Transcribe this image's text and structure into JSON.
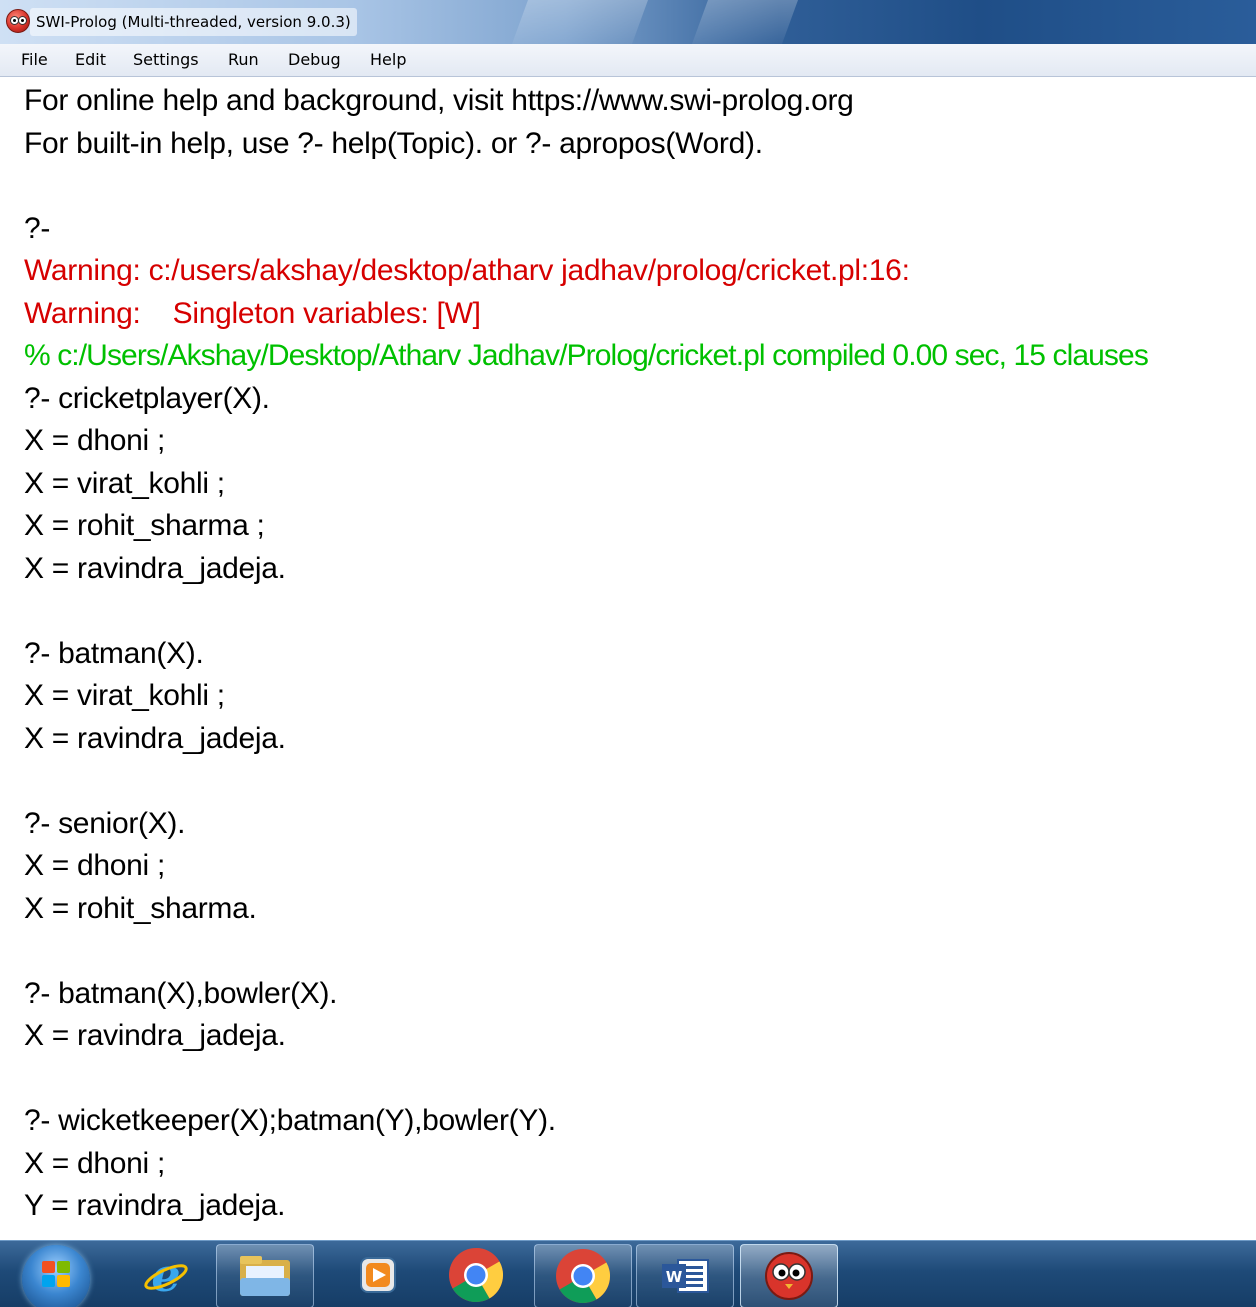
{
  "window": {
    "title": "SWI-Prolog (Multi-threaded, version 9.0.3)"
  },
  "menu": {
    "items": [
      {
        "label": "File"
      },
      {
        "label": "Edit"
      },
      {
        "label": "Settings"
      },
      {
        "label": "Run"
      },
      {
        "label": "Debug"
      },
      {
        "label": "Help"
      }
    ]
  },
  "console": {
    "lines": [
      {
        "text": "For online help and background, visit https://www.swi-prolog.org",
        "kind": "normal"
      },
      {
        "text": "For built-in help, use ?- help(Topic). or ?- apropos(Word).",
        "kind": "normal"
      },
      {
        "text": "",
        "kind": "normal"
      },
      {
        "text": "?-",
        "kind": "normal"
      },
      {
        "text": "Warning: c:/users/akshay/desktop/atharv jadhav/prolog/cricket.pl:16:",
        "kind": "warning"
      },
      {
        "text": "Warning:    Singleton variables: [W]",
        "kind": "warning"
      },
      {
        "text": "% c:/Users/Akshay/Desktop/Atharv Jadhav/Prolog/cricket.pl compiled 0.00 sec, 15 clauses",
        "kind": "success"
      },
      {
        "text": "?- cricketplayer(X).",
        "kind": "normal"
      },
      {
        "text": "X = dhoni ;",
        "kind": "normal"
      },
      {
        "text": "X = virat_kohli ;",
        "kind": "normal"
      },
      {
        "text": "X = rohit_sharma ;",
        "kind": "normal"
      },
      {
        "text": "X = ravindra_jadeja.",
        "kind": "normal"
      },
      {
        "text": "",
        "kind": "normal"
      },
      {
        "text": "?- batman(X).",
        "kind": "normal"
      },
      {
        "text": "X = virat_kohli ;",
        "kind": "normal"
      },
      {
        "text": "X = ravindra_jadeja.",
        "kind": "normal"
      },
      {
        "text": "",
        "kind": "normal"
      },
      {
        "text": "?- senior(X).",
        "kind": "normal"
      },
      {
        "text": "X = dhoni ;",
        "kind": "normal"
      },
      {
        "text": "X = rohit_sharma.",
        "kind": "normal"
      },
      {
        "text": "",
        "kind": "normal"
      },
      {
        "text": "?- batman(X),bowler(X).",
        "kind": "normal"
      },
      {
        "text": "X = ravindra_jadeja.",
        "kind": "normal"
      },
      {
        "text": "",
        "kind": "normal"
      },
      {
        "text": "?- wicketkeeper(X);batman(Y),bowler(Y).",
        "kind": "normal"
      },
      {
        "text": "X = dhoni ;",
        "kind": "normal"
      },
      {
        "text": "Y = ravindra_jadeja.",
        "kind": "normal"
      }
    ]
  },
  "taskbar": {
    "items": [
      {
        "icon": "windows-start-icon"
      },
      {
        "icon": "internet-explorer-icon"
      },
      {
        "icon": "file-explorer-icon"
      },
      {
        "icon": "media-player-icon"
      },
      {
        "icon": "chrome-icon"
      },
      {
        "icon": "chrome-icon"
      },
      {
        "icon": "word-icon"
      },
      {
        "icon": "swi-prolog-icon"
      }
    ]
  },
  "colors": {
    "warning": "#d60000",
    "success": "#00c000",
    "text": "#000000",
    "background": "#ffffff"
  }
}
